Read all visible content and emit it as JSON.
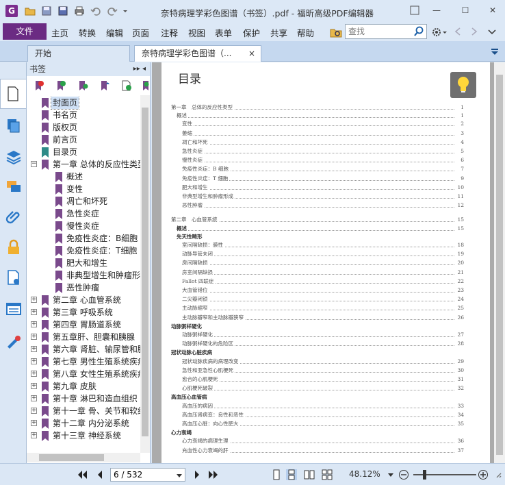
{
  "app": {
    "title": "奈特病理学彩色图谱（书签）.pdf - 福昕高级PDF编辑器",
    "logo_letter": "G"
  },
  "menu": {
    "file": "文件",
    "items": [
      "主页",
      "转换",
      "编辑",
      "页面",
      "注释",
      "视图",
      "表单",
      "保护",
      "共享",
      "帮助"
    ],
    "search_placeholder": "查找"
  },
  "tabs": [
    {
      "label": "开始"
    },
    {
      "label": "奈特病理学彩色图谱（...",
      "close": "×"
    }
  ],
  "bookmarks": {
    "header": "书签",
    "header_controls": "▸▸ ◂",
    "items": [
      {
        "label": "封面页",
        "level": 1,
        "selected": true
      },
      {
        "label": "书名页",
        "level": 1
      },
      {
        "label": "版权页",
        "level": 1
      },
      {
        "label": "前言页",
        "level": 1
      },
      {
        "label": "目录页",
        "level": 1
      },
      {
        "label": "第一章 总体的反应性类型",
        "level": 1,
        "expander": "−"
      },
      {
        "label": "概述",
        "level": 2
      },
      {
        "label": "变性",
        "level": 2
      },
      {
        "label": "凋亡和坏死",
        "level": 2
      },
      {
        "label": "急性炎症",
        "level": 2
      },
      {
        "label": "慢性炎症",
        "level": 2
      },
      {
        "label": "免疫性炎症：B细胞",
        "level": 2
      },
      {
        "label": "免疫性炎症：T细胞",
        "level": 2
      },
      {
        "label": "肥大和增生",
        "level": 2
      },
      {
        "label": "非典型增生和肿瘤形成",
        "level": 2
      },
      {
        "label": "恶性肿瘤",
        "level": 2
      },
      {
        "label": "第二章 心血管系统",
        "level": 1,
        "expander": "+"
      },
      {
        "label": "第三章 呼吸系统",
        "level": 1,
        "expander": "+"
      },
      {
        "label": "第四章 胃肠道系统",
        "level": 1,
        "expander": "+"
      },
      {
        "label": "第五章肝、胆囊和胰腺",
        "level": 1,
        "expander": "+"
      },
      {
        "label": "第六章 肾脏、输尿管和膀胱",
        "level": 1,
        "expander": "+"
      },
      {
        "label": "第七章 男性生殖系统疾病",
        "level": 1,
        "expander": "+"
      },
      {
        "label": "第八章 女性生殖系统疾病",
        "level": 1,
        "expander": "+"
      },
      {
        "label": "第九章 皮肤",
        "level": 1,
        "expander": "+"
      },
      {
        "label": "第十章 淋巴和造血组织",
        "level": 1,
        "expander": "+"
      },
      {
        "label": "第十一章 骨、关节和软组织",
        "level": 1,
        "expander": "+"
      },
      {
        "label": "第十二章 内分泌系统",
        "level": 1,
        "expander": "+"
      },
      {
        "label": "第十三章 神经系统",
        "level": 1,
        "expander": "+"
      }
    ]
  },
  "document": {
    "heading": "目录",
    "toc": [
      {
        "text": "第一章　总体的反应性类型",
        "page": "1",
        "indent": 0
      },
      {
        "text": "概述",
        "page": "1",
        "indent": 1
      },
      {
        "text": "变性",
        "page": "2",
        "indent": 2
      },
      {
        "text": "萎缩",
        "page": "3",
        "indent": 2
      },
      {
        "text": "凋亡和坏死",
        "page": "4",
        "indent": 2
      },
      {
        "text": "急性炎症",
        "page": "5",
        "indent": 2
      },
      {
        "text": "慢性炎症",
        "page": "6",
        "indent": 2
      },
      {
        "text": "免疫性炎症：B 细胞",
        "page": "7",
        "indent": 2
      },
      {
        "text": "免疫性炎症：T 细胞",
        "page": "9",
        "indent": 2
      },
      {
        "text": "肥大和增生",
        "page": "10",
        "indent": 2
      },
      {
        "text": "非典型增生和肿瘤形成",
        "page": "11",
        "indent": 2
      },
      {
        "text": "恶性肿瘤",
        "page": "12",
        "indent": 2
      },
      {
        "text": "第二章　心血管系统",
        "page": "15",
        "indent": 0,
        "gap": true
      },
      {
        "text": "概述",
        "page": "15",
        "indent": 1,
        "bold": true
      },
      {
        "text": "先天性畸形",
        "page": "",
        "indent": 1,
        "bold": true
      },
      {
        "text": "室间隔缺损：膜性",
        "page": "18",
        "indent": 2
      },
      {
        "text": "动脉导管未闭",
        "page": "19",
        "indent": 2
      },
      {
        "text": "房间隔缺损",
        "page": "20",
        "indent": 2
      },
      {
        "text": "房室间隔缺损",
        "page": "21",
        "indent": 2
      },
      {
        "text": "Fallot 四联症",
        "page": "22",
        "indent": 2
      },
      {
        "text": "大血管错位",
        "page": "23",
        "indent": 2
      },
      {
        "text": "二尖瓣闭锁",
        "page": "24",
        "indent": 2
      },
      {
        "text": "主动脉缩窄",
        "page": "25",
        "indent": 2
      },
      {
        "text": "主动脉瓣窄和主动脉瓣狭窄",
        "page": "26",
        "indent": 2
      },
      {
        "text": "动脉粥样硬化",
        "page": "",
        "indent": 0,
        "bold": true
      },
      {
        "text": "动脉粥样硬化",
        "page": "27",
        "indent": 2
      },
      {
        "text": "动脉粥样硬化的危险区",
        "page": "28",
        "indent": 2
      },
      {
        "text": "冠状动脉心脏疾病",
        "page": "",
        "indent": 0,
        "bold": true
      },
      {
        "text": "冠状动脉疾病的病理改变",
        "page": "29",
        "indent": 2
      },
      {
        "text": "急性和亚急性心肌梗死",
        "page": "30",
        "indent": 2
      },
      {
        "text": "愈合的心肌梗死",
        "page": "31",
        "indent": 2
      },
      {
        "text": "心肌梗死破裂",
        "page": "32",
        "indent": 2
      },
      {
        "text": "高血压心血管病",
        "page": "",
        "indent": 0,
        "bold": true
      },
      {
        "text": "高血压的病因",
        "page": "33",
        "indent": 2
      },
      {
        "text": "高血压肾病变：良性和恶性",
        "page": "34",
        "indent": 2
      },
      {
        "text": "高血压心脏：向心性肥大",
        "page": "35",
        "indent": 2
      },
      {
        "text": "心力衰竭",
        "page": "",
        "indent": 0,
        "bold": true
      },
      {
        "text": "心力衰竭的病理生理",
        "page": "36",
        "indent": 2
      },
      {
        "text": "充血性心力衰竭的肝",
        "page": "37",
        "indent": 2
      }
    ]
  },
  "status": {
    "page_value": "6 / 532",
    "zoom": "48.12%"
  },
  "colors": {
    "accent": "#6b2b83",
    "bookmark_flag": "#7a4a8c",
    "bookmark_flag_teal": "#2e8b88"
  }
}
